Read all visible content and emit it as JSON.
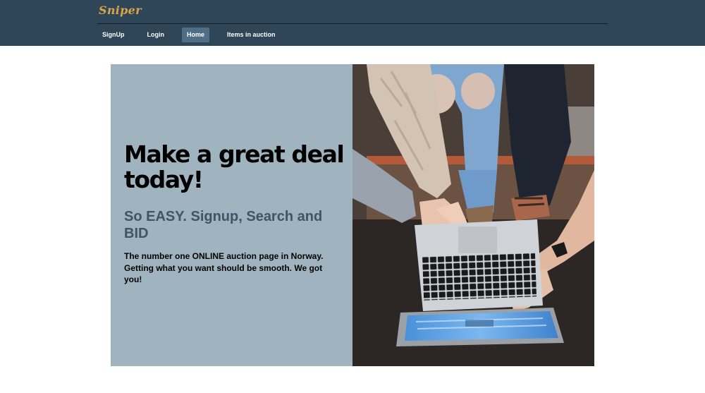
{
  "header": {
    "brand": "Sniper",
    "nav": [
      {
        "label": "SignUp",
        "active": false
      },
      {
        "label": "Login",
        "active": false
      },
      {
        "label": "Home",
        "active": true
      },
      {
        "label": "Items in auction",
        "active": false
      }
    ]
  },
  "hero": {
    "headline": "Make a great deal today!",
    "subheadline": "So EASY. Signup, Search and BID",
    "description": "The number one ONLINE auction page in Norway. Getting what you want should be smooth. We got you!",
    "image": "laptop-photo"
  },
  "colors": {
    "header_bg": "#2f4558",
    "brand": "#d9a44a",
    "active_nav_bg": "#4f6d84",
    "hero_panel_bg": "#9fb4bf",
    "subheadline": "#3d5566"
  }
}
